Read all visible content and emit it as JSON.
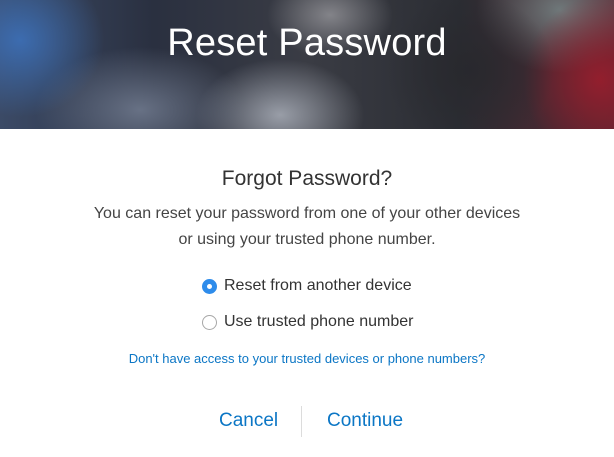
{
  "header": {
    "title": "Reset Password"
  },
  "main": {
    "heading": "Forgot Password?",
    "description_line1": "You can reset your password from one of your other devices",
    "description_line2": "or using your trusted phone number.",
    "options": [
      {
        "label": "Reset from another device",
        "selected": true
      },
      {
        "label": "Use trusted phone number",
        "selected": false
      }
    ],
    "help_link": "Don't have access to your trusted devices or phone numbers?"
  },
  "footer": {
    "cancel_label": "Cancel",
    "continue_label": "Continue"
  },
  "colors": {
    "accent": "#0b76c5",
    "radio_selected": "#2e8ceb"
  }
}
